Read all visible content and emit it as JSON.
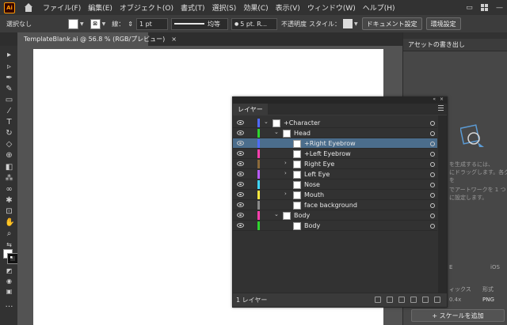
{
  "app": {
    "logo": "Ai"
  },
  "menu": [
    "ファイル(F)",
    "編集(E)",
    "オブジェクト(O)",
    "書式(T)",
    "選択(S)",
    "効果(C)",
    "表示(V)",
    "ウィンドウ(W)",
    "ヘルプ(H)"
  ],
  "control": {
    "selection": "選択なし",
    "stroke_label": "線：",
    "stroke_weight": "1 pt",
    "profile": "均等",
    "brush": "5 pt. R...",
    "opacity_label": "不透明度",
    "style_label": "スタイル：",
    "doc_setup": "ドキュメント設定",
    "prefs": "環境設定"
  },
  "document": {
    "tab_title": "TemplateBlank.ai @ 56.8 % (RGB/プレビュー)",
    "close": "×"
  },
  "assets": {
    "tab": "アセットの書き出し",
    "text1": "を生成するには、",
    "text2": "にドラッグします。各グ",
    "text3": "を",
    "text4": "でアートワークを 1 つ",
    "text5": "に設定します。",
    "ios": "iOS",
    "section": "ィックス",
    "format_label": "形式",
    "scale": "0.4x",
    "format": "PNG",
    "add_scale": "+ スケールを追加",
    "partial_e": "E"
  },
  "layers_panel": {
    "tab": "レイヤー",
    "count": "1 レイヤー",
    "rows": [
      {
        "name": "+Character",
        "color": "#4f6bff"
      },
      {
        "name": "Head",
        "color": "#2ed62e"
      },
      {
        "name": "+Right Eyebrow",
        "color": "#4f6bff",
        "selected": true
      },
      {
        "name": "+Left Eyebrow",
        "color": "#ff3fae"
      },
      {
        "name": "Right Eye",
        "color": "#8b6a3a"
      },
      {
        "name": "Left Eye",
        "color": "#b85aff"
      },
      {
        "name": "Nose",
        "color": "#3fd6ff"
      },
      {
        "name": "Mouth",
        "color": "#ffe83f"
      },
      {
        "name": "face background",
        "color": "#8a8a8a"
      },
      {
        "name": "Body",
        "color": "#ff3fae"
      },
      {
        "name": "Body",
        "color": "#2ed62e"
      }
    ]
  }
}
